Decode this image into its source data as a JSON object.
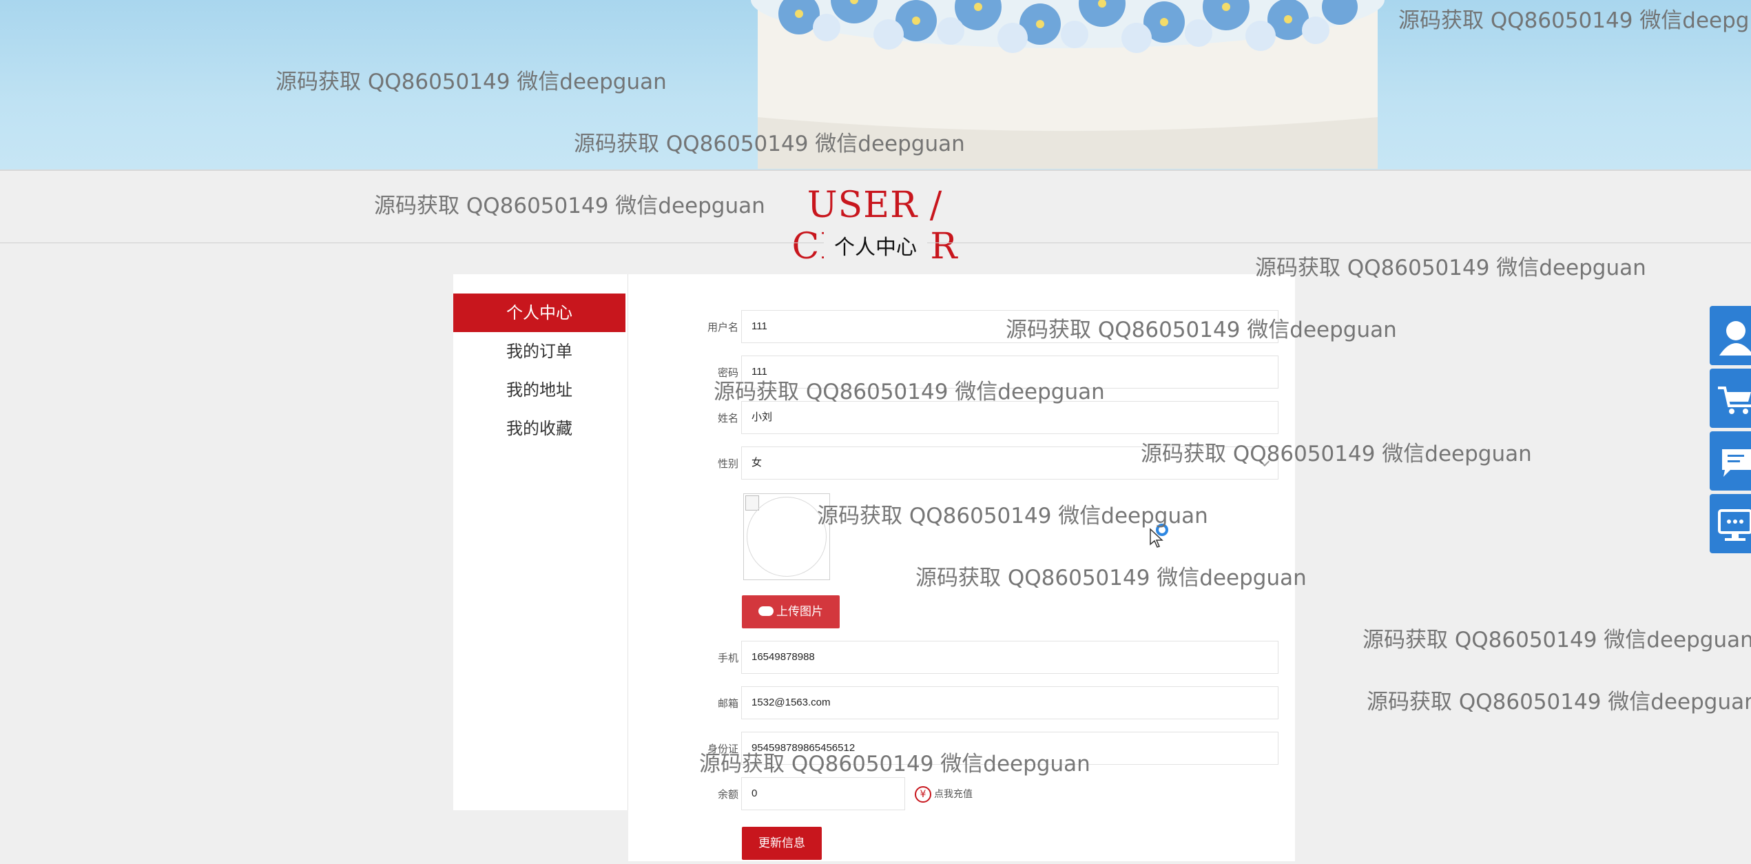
{
  "header": {
    "title_en": "USER / CENTER",
    "title_cn": "个人中心"
  },
  "sidebar": {
    "items": [
      {
        "label": "个人中心",
        "active": true
      },
      {
        "label": "我的订单",
        "active": false
      },
      {
        "label": "我的地址",
        "active": false
      },
      {
        "label": "我的收藏",
        "active": false
      }
    ]
  },
  "form": {
    "username": {
      "label": "用户名",
      "value": "111"
    },
    "password": {
      "label": "密码",
      "value": "111"
    },
    "name": {
      "label": "姓名",
      "value": "小刘"
    },
    "gender": {
      "label": "性别",
      "value": "女"
    },
    "upload_label": "上传图片",
    "phone": {
      "label": "手机",
      "value": "16549878988"
    },
    "email": {
      "label": "邮箱",
      "value": "1532@1563.com"
    },
    "idcard": {
      "label": "身份证",
      "value": "954598789865456512"
    },
    "balance": {
      "label": "余额",
      "value": "0"
    },
    "recharge_label": "点我充值",
    "recharge_symbol": "¥",
    "submit_label": "更新信息"
  },
  "watermark": "源码获取 QQ86050149 微信deepguan",
  "colors": {
    "brand": "#c8161d",
    "toolbar": "#2d7fd4"
  },
  "toolbar": [
    "user-icon",
    "cart-icon",
    "message-icon",
    "monitor-chat-icon"
  ]
}
